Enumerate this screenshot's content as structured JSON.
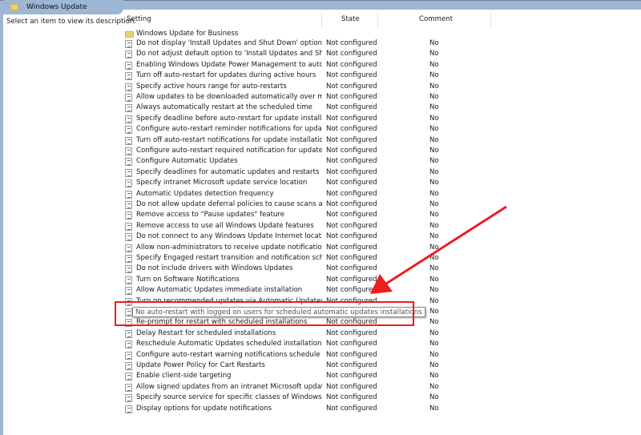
{
  "window": {
    "title": "Windows Update",
    "description_prompt": "Select an item to view its description."
  },
  "columns": {
    "setting": "Setting",
    "state": "State",
    "comment": "Comment"
  },
  "folder": {
    "label": "Windows Update for Business"
  },
  "rows": [
    {
      "name": "Do not display 'Install Updates and Shut Down' option in Sh...",
      "state": "Not configured",
      "comment": "No"
    },
    {
      "name": "Do not adjust default option to 'Install Updates and Shut Do...",
      "state": "Not configured",
      "comment": "No"
    },
    {
      "name": "Enabling Windows Update Power Management to automati...",
      "state": "Not configured",
      "comment": "No"
    },
    {
      "name": "Turn off auto-restart for updates during active hours",
      "state": "Not configured",
      "comment": "No"
    },
    {
      "name": "Specify active hours range for auto-restarts",
      "state": "Not configured",
      "comment": "No"
    },
    {
      "name": "Allow updates to be downloaded automatically over metere...",
      "state": "Not configured",
      "comment": "No"
    },
    {
      "name": "Always automatically restart at the scheduled time",
      "state": "Not configured",
      "comment": "No"
    },
    {
      "name": "Specify deadline before auto-restart for update installation",
      "state": "Not configured",
      "comment": "No"
    },
    {
      "name": "Configure auto-restart reminder notifications for updates",
      "state": "Not configured",
      "comment": "No"
    },
    {
      "name": "Turn off auto-restart notifications for update installations",
      "state": "Not configured",
      "comment": "No"
    },
    {
      "name": "Configure auto-restart required notification for updates",
      "state": "Not configured",
      "comment": "No"
    },
    {
      "name": "Configure Automatic Updates",
      "state": "Not configured",
      "comment": "No"
    },
    {
      "name": "Specify deadlines for automatic updates and restarts",
      "state": "Not configured",
      "comment": "No"
    },
    {
      "name": "Specify intranet Microsoft update service location",
      "state": "Not configured",
      "comment": "No"
    },
    {
      "name": "Automatic Updates detection frequency",
      "state": "Not configured",
      "comment": "No"
    },
    {
      "name": "Do not allow update deferral policies to cause scans against ...",
      "state": "Not configured",
      "comment": "No"
    },
    {
      "name": "Remove access to \"Pause updates\" feature",
      "state": "Not configured",
      "comment": "No"
    },
    {
      "name": "Remove access to use all Windows Update features",
      "state": "Not configured",
      "comment": "No"
    },
    {
      "name": "Do not connect to any Windows Update Internet locations",
      "state": "Not configured",
      "comment": "No"
    },
    {
      "name": "Allow non-administrators to receive update notifications",
      "state": "Not configured",
      "comment": "No"
    },
    {
      "name": "Specify Engaged restart transition and notification schedule ...",
      "state": "Not configured",
      "comment": "No"
    },
    {
      "name": "Do not include drivers with Windows Updates",
      "state": "Not configured",
      "comment": "No"
    },
    {
      "name": "Turn on Software Notifications",
      "state": "Not configured",
      "comment": "No"
    },
    {
      "name": "Allow Automatic Updates immediate installation",
      "state": "Not configured",
      "comment": "No"
    },
    {
      "name": "Turn on recommended updates via Automatic Updates",
      "state": "Not configured",
      "comment": "No"
    },
    {
      "name": "No auto-restart with logged on users for scheduled automatic updates installations",
      "state": "Not configured",
      "comment": "No"
    },
    {
      "name": "Re-prompt for restart with scheduled installations",
      "state": "Not configured",
      "comment": "No"
    },
    {
      "name": "Delay Restart for scheduled installations",
      "state": "Not configured",
      "comment": "No"
    },
    {
      "name": "Reschedule Automatic Updates scheduled installations",
      "state": "Not configured",
      "comment": "No"
    },
    {
      "name": "Configure auto-restart warning notifications schedule for u...",
      "state": "Not configured",
      "comment": "No"
    },
    {
      "name": "Update Power Policy for Cart Restarts",
      "state": "Not configured",
      "comment": "No"
    },
    {
      "name": "Enable client-side targeting",
      "state": "Not configured",
      "comment": "No"
    },
    {
      "name": "Allow signed updates from an intranet Microsoft update ser...",
      "state": "Not configured",
      "comment": "No"
    },
    {
      "name": "Specify source service for specific classes of Windows Updat...",
      "state": "Not configured",
      "comment": "No"
    },
    {
      "name": "Display options for update notifications",
      "state": "Not configured",
      "comment": "No"
    }
  ],
  "tooltip": {
    "text": "No auto-restart with logged on users for scheduled automatic updates installations"
  },
  "annotation": {
    "color": "#ee1c1c"
  }
}
